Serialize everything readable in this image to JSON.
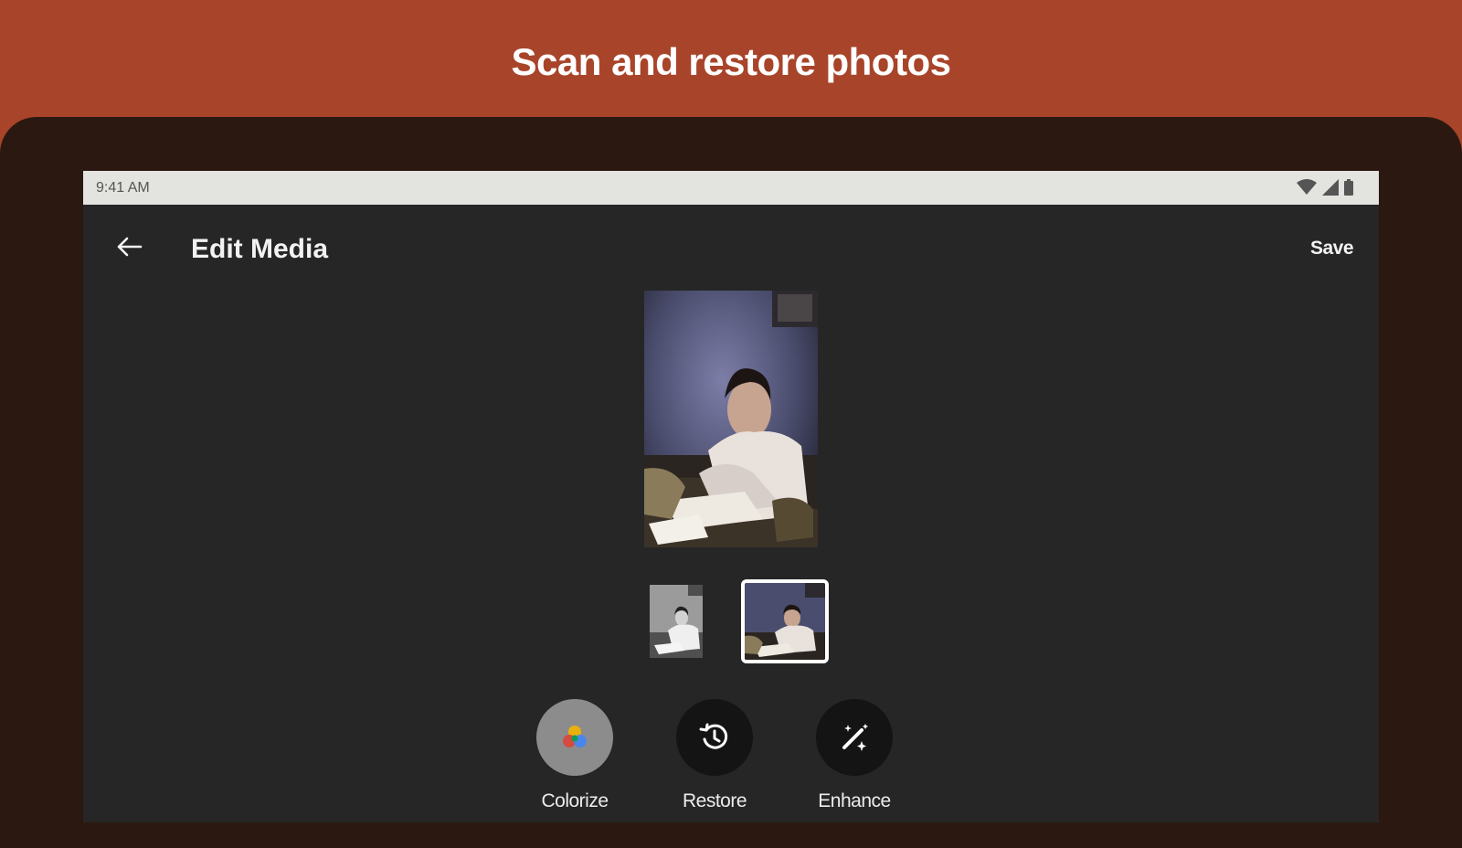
{
  "headline": "Scan and restore photos",
  "status_bar": {
    "time": "9:41 AM",
    "icons": [
      "wifi-icon",
      "signal-icon",
      "battery-icon"
    ]
  },
  "app_bar": {
    "back_icon": "arrow-left-icon",
    "title": "Edit Media",
    "save_label": "Save"
  },
  "thumbnails": [
    {
      "variant": "original-black-and-white",
      "selected": false
    },
    {
      "variant": "colorized",
      "selected": true
    }
  ],
  "tools": [
    {
      "label": "Colorize",
      "icon": "color-wheel-icon",
      "active": true
    },
    {
      "label": "Restore",
      "icon": "history-icon",
      "active": false
    },
    {
      "label": "Enhance",
      "icon": "magic-wand-icon",
      "active": false
    }
  ],
  "colors": {
    "banner": "#a8442a",
    "device_frame": "#2b1810",
    "screen_background": "#262626",
    "status_bar": "#e3e3df"
  }
}
